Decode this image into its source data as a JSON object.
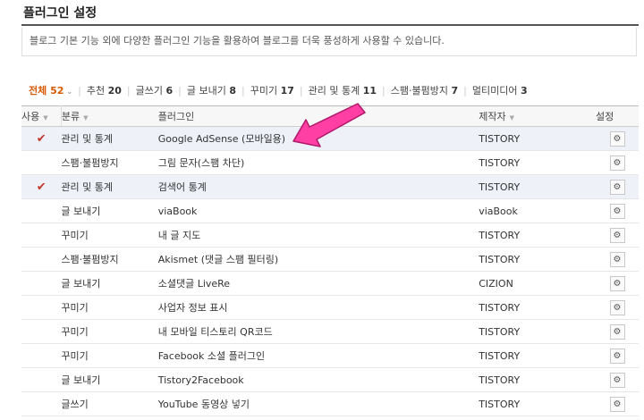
{
  "page": {
    "title": "플러그인 설정",
    "description": "블로그 기본 기능 외에 다양한 플러그인 기능을 활용하여 블로그를 더욱 풍성하게 사용할 수 있습니다."
  },
  "filters": [
    {
      "label": "전체",
      "count": "52",
      "active": true
    },
    {
      "label": "추천",
      "count": "20"
    },
    {
      "label": "글쓰기",
      "count": "6"
    },
    {
      "label": "글 보내기",
      "count": "8"
    },
    {
      "label": "꾸미기",
      "count": "17"
    },
    {
      "label": "관리 및 통계",
      "count": "11"
    },
    {
      "label": "스팸·불펌방지",
      "count": "7"
    },
    {
      "label": "멀티미디어",
      "count": "3"
    }
  ],
  "table": {
    "headers": {
      "use": "사용",
      "category": "분류",
      "name": "플러그인",
      "maker": "제작자",
      "settings": "설정"
    },
    "check_mark": "✔",
    "rows": [
      {
        "checked": true,
        "category": "관리 및 통계",
        "name": "Google AdSense (모바일용)",
        "maker": "TISTORY"
      },
      {
        "checked": false,
        "category": "스팸·불펌방지",
        "name": "그림 문자(스팸 차단)",
        "maker": "TISTORY"
      },
      {
        "checked": true,
        "category": "관리 및 통계",
        "name": "검색어 통계",
        "maker": "TISTORY"
      },
      {
        "checked": false,
        "category": "글 보내기",
        "name": "viaBook",
        "maker": "viaBook"
      },
      {
        "checked": false,
        "category": "꾸미기",
        "name": "내 글 지도",
        "maker": "TISTORY"
      },
      {
        "checked": false,
        "category": "스팸·불펌방지",
        "name": "Akismet (댓글 스팸 필터링)",
        "maker": "TISTORY"
      },
      {
        "checked": false,
        "category": "글 보내기",
        "name": "소셜댓글 LiveRe",
        "maker": "CIZION"
      },
      {
        "checked": false,
        "category": "꾸미기",
        "name": "사업자 정보 표시",
        "maker": "TISTORY"
      },
      {
        "checked": false,
        "category": "꾸미기",
        "name": "내 모바일 티스토리 QR코드",
        "maker": "TISTORY"
      },
      {
        "checked": false,
        "category": "꾸미기",
        "name": "Facebook 소셜 플러그인",
        "maker": "TISTORY"
      },
      {
        "checked": false,
        "category": "글 보내기",
        "name": "Tistory2Facebook",
        "maker": "TISTORY"
      },
      {
        "checked": false,
        "category": "글쓰기",
        "name": "YouTube 동영상 넣기",
        "maker": "TISTORY"
      }
    ]
  },
  "icons": {
    "settings": "gear-icon",
    "sort": "caret-down-icon",
    "annotation": "pink-arrow-icon"
  },
  "colors": {
    "active_filter": "#d65a06",
    "check": "#c0392b",
    "checked_row": "#eef1f8",
    "arrow": "#ff3fa4"
  }
}
